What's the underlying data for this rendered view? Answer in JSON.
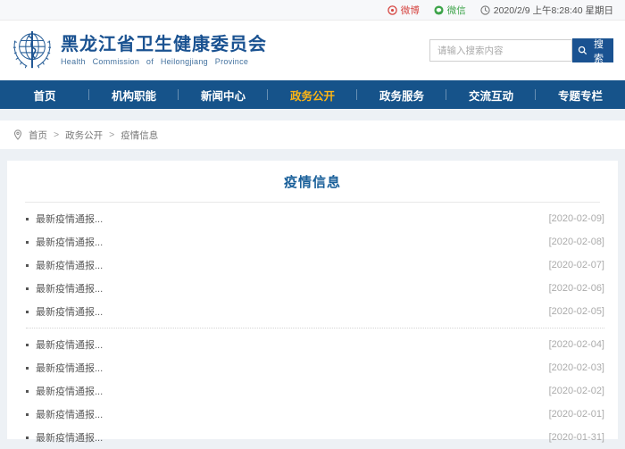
{
  "topbar": {
    "weibo_label": "微博",
    "wechat_label": "微信",
    "datetime": "2020/2/9 上午8:28:40 星期日"
  },
  "header": {
    "site_title": "黑龙江省卫生健康委员会",
    "site_subtitle": "Health Commission of Heilongjiang Province",
    "search_placeholder": "请输入搜索内容",
    "search_button_label": "搜索"
  },
  "nav": {
    "items": [
      {
        "label": "首页",
        "active": false
      },
      {
        "label": "机构职能",
        "active": false
      },
      {
        "label": "新闻中心",
        "active": false
      },
      {
        "label": "政务公开",
        "active": true
      },
      {
        "label": "政务服务",
        "active": false
      },
      {
        "label": "交流互动",
        "active": false
      },
      {
        "label": "专题专栏",
        "active": false
      }
    ]
  },
  "breadcrumb": {
    "separator": ">",
    "items": [
      "首页",
      "政务公开",
      "疫情信息"
    ]
  },
  "content": {
    "title": "疫情信息",
    "groups": [
      {
        "items": [
          {
            "title": "最新疫情通报...",
            "date": "[2020-02-09]"
          },
          {
            "title": "最新疫情通报...",
            "date": "[2020-02-08]"
          },
          {
            "title": "最新疫情通报...",
            "date": "[2020-02-07]"
          },
          {
            "title": "最新疫情通报...",
            "date": "[2020-02-06]"
          },
          {
            "title": "最新疫情通报...",
            "date": "[2020-02-05]"
          }
        ]
      },
      {
        "items": [
          {
            "title": "最新疫情通报...",
            "date": "[2020-02-04]"
          },
          {
            "title": "最新疫情通报...",
            "date": "[2020-02-03]"
          },
          {
            "title": "最新疫情通报...",
            "date": "[2020-02-02]"
          },
          {
            "title": "最新疫情通报...",
            "date": "[2020-02-01]"
          },
          {
            "title": "最新疫情通报...",
            "date": "[2020-01-31]"
          }
        ]
      }
    ]
  },
  "colors": {
    "nav_bg": "#16538a",
    "nav_active": "#fdb515",
    "brand_blue": "#1a5291",
    "title_blue": "#1a609a",
    "weibo_red": "#d64541",
    "wechat_green": "#3ea44a",
    "page_bg": "#edf1f5"
  }
}
